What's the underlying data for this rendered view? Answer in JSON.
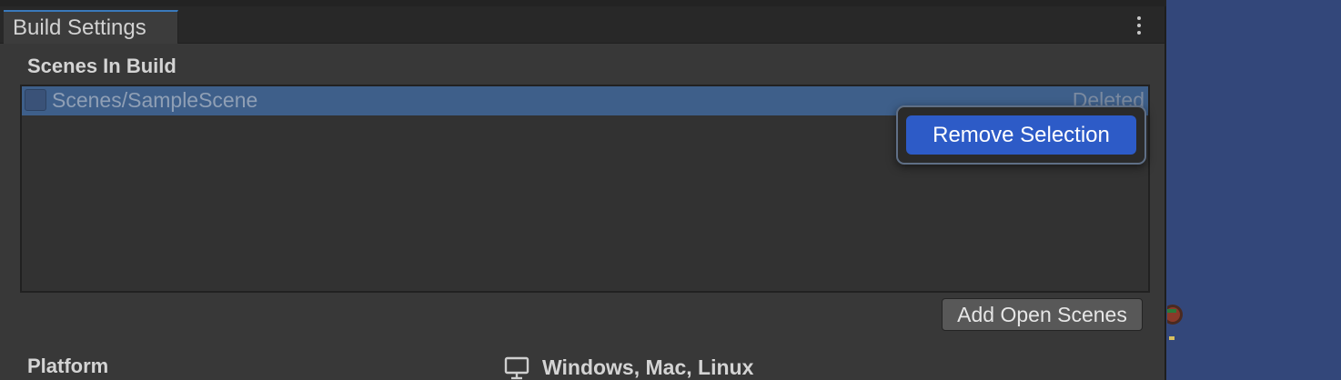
{
  "window": {
    "tab_title": "Build Settings"
  },
  "scenes": {
    "section_title": "Scenes In Build",
    "items": [
      {
        "name": "Scenes/SampleScene",
        "status": "Deleted",
        "checked": false
      }
    ]
  },
  "context_menu": {
    "items": [
      {
        "label": "Remove Selection"
      }
    ]
  },
  "actions": {
    "add_open_scenes_label": "Add Open Scenes"
  },
  "platform": {
    "label": "Platform",
    "selected_name": "Windows, Mac, Linux",
    "selected_icon": "monitor-icon"
  },
  "colors": {
    "selection": "#3e5f8a",
    "menu_highlight": "#2d5bc7",
    "desktop_background": "#33477a"
  }
}
